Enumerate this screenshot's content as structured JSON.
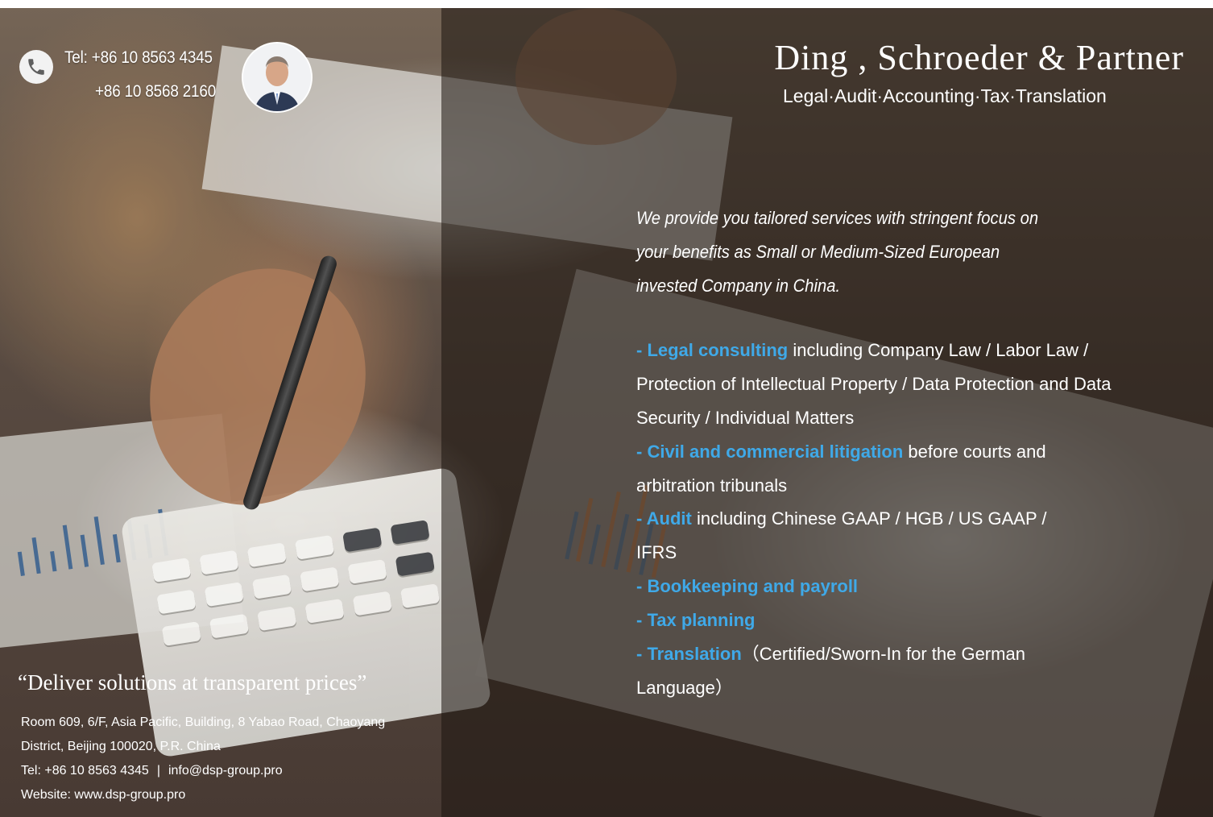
{
  "contact": {
    "tel_line_1": "Tel: +86 10 8563 4345",
    "tel_line_2": "+86 10 8568 2160"
  },
  "brand": {
    "name": "Ding , Schroeder & Partner",
    "services_tagline": "Legal·Audit·Accounting·Tax·Translation"
  },
  "intro_text": "We provide you tailored services with stringent focus on your benefits as Small or Medium-Sized European invested Company in China.",
  "services": [
    {
      "highlight": "- Legal consulting",
      "text": " including Company Law / Labor Law / Protection of Intellectual Property / Data Protection and Data Security / Individual Matters"
    },
    {
      "highlight": "- Civil and commercial litigation",
      "text": " before courts and arbitration tribunals"
    },
    {
      "highlight": "- Audit",
      "text": " including Chinese GAAP / HGB / US GAAP / IFRS"
    },
    {
      "highlight": "- Bookkeeping and payroll",
      "text": ""
    },
    {
      "highlight": "- Tax planning",
      "text": ""
    },
    {
      "highlight": "- Translation",
      "text": "（Certified/Sworn-In for the German Language）"
    }
  ],
  "footer": {
    "quote": "“Deliver solutions at transparent prices”",
    "address_line_1": "Room 609, 6/F, Asia Pacific, Building, 8 Yabao Road, Chaoyang",
    "address_line_2": "District, Beijing 100020, P.R. China",
    "tel": "Tel: +86 10 8563 4345",
    "separator": "|",
    "email": "info@dsp-group.pro",
    "website": "Website: www.dsp-group.pro"
  },
  "colors": {
    "highlight": "#3fa9e8",
    "text": "#ffffff",
    "overlay_right": "rgba(40,32,28,0.58)"
  },
  "icons": [
    "phone-icon",
    "avatar"
  ]
}
